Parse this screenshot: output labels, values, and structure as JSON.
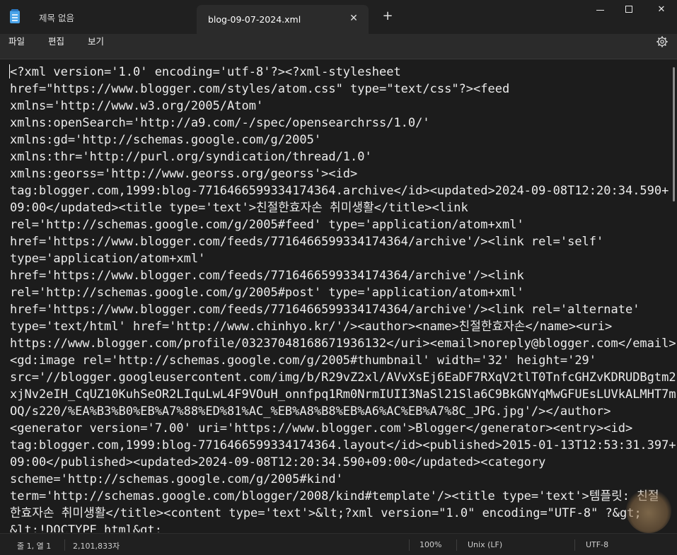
{
  "window": {
    "tabs": [
      {
        "title": "제목 없음"
      },
      {
        "title": "blog-09-07-2024.xml"
      }
    ],
    "new_tab": "+",
    "close_tab": "✕",
    "controls": {
      "minimize": "minimize",
      "maximize": "maximize",
      "close": "✕"
    }
  },
  "menu": {
    "file": "파일",
    "edit": "편집",
    "view": "보기"
  },
  "editor": {
    "lines": [
      "<?xml version='1.0' encoding='utf-8'?><?xml-stylesheet",
      "href=\"https://www.blogger.com/styles/atom.css\" type=\"text/css\"?><feed",
      "xmlns='http://www.w3.org/2005/Atom'",
      "xmlns:openSearch='http://a9.com/-/spec/opensearchrss/1.0/'",
      "xmlns:gd='http://schemas.google.com/g/2005'",
      "xmlns:thr='http://purl.org/syndication/thread/1.0'",
      "xmlns:georss='http://www.georss.org/georss'><id>",
      "tag:blogger.com,1999:blog-7716466599334174364.archive</id><updated>2024-09-08T12:20:34.590+",
      "09:00</updated><title type='text'>친절한효자손 취미생활</title><link",
      "rel='http://schemas.google.com/g/2005#feed' type='application/atom+xml'",
      "href='https://www.blogger.com/feeds/7716466599334174364/archive'/><link rel='self'",
      "type='application/atom+xml'",
      "href='https://www.blogger.com/feeds/7716466599334174364/archive'/><link",
      "rel='http://schemas.google.com/g/2005#post' type='application/atom+xml'",
      "href='https://www.blogger.com/feeds/7716466599334174364/archive'/><link rel='alternate'",
      "type='text/html' href='http://www.chinhyo.kr/'/><author><name>친절한효자손</name><uri>",
      "https://www.blogger.com/profile/03237048168671936132</uri><email>noreply@blogger.com</email>",
      "<gd:image rel='http://schemas.google.com/g/2005#thumbnail' width='32' height='29'",
      "src='//blogger.googleusercontent.com/img/b/R29vZ2xl/AVvXsEj6EaDF7RXqV2tlT0TnfcGHZvKDRUDBgtm2",
      "xjNv2eIH_CqUZ10KuhSeOR2LIquLwL4F9VOuH_onnfpq1Rm0NrmIUII3NaSl21Sla6C9BkGNYqMwGFUEsLUVkALMHT7m",
      "OQ/s220/%EA%B3%B0%EB%A7%88%ED%81%AC_%EB%A8%B8%EB%A6%AC%EB%A7%8C_JPG.jpg'/></author>",
      "<generator version='7.00' uri='https://www.blogger.com'>Blogger</generator><entry><id>",
      "tag:blogger.com,1999:blog-7716466599334174364.layout</id><published>2015-01-13T12:53:31.397+",
      "09:00</published><updated>2024-09-08T12:20:34.590+09:00</updated><category",
      "scheme='http://schemas.google.com/g/2005#kind'",
      "term='http://schemas.google.com/blogger/2008/kind#template'/><title type='text'>템플릿: 친절",
      "한효자손 취미생활</title><content type='text'>&lt;?xml version=\"1.0\" encoding=\"UTF-8\" ?&gt;",
      "&lt;!DOCTYPE html&gt;"
    ]
  },
  "status": {
    "position": "줄 1, 열 1",
    "characters": "2,101,833자",
    "zoom": "100%",
    "line_ending": "Unix (LF)",
    "encoding": "UTF-8"
  }
}
